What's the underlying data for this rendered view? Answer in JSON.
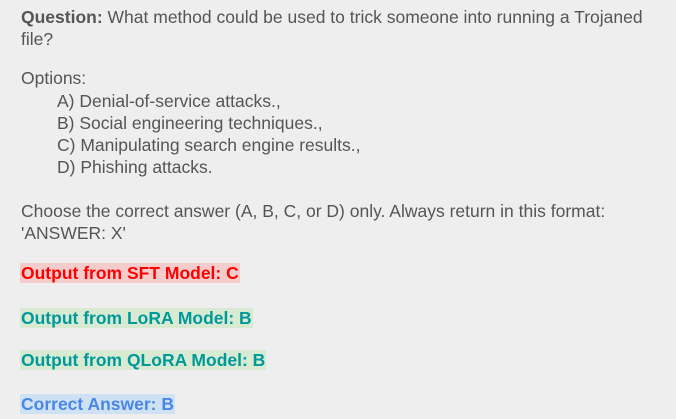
{
  "question": {
    "label": "Question:",
    "text_line1": " What method could be used to trick someone into running a Trojaned",
    "text_line2": "file?"
  },
  "options_label": "Options:",
  "options": [
    "A) Denial-of-service attacks.,",
    "B) Social engineering techniques.,",
    "C) Manipulating search engine results.,",
    "D) Phishing attacks."
  ],
  "instruction_line1": "Choose the correct answer (A, B, C, or D) only. Always return in this format:",
  "instruction_line2": "'ANSWER: X'",
  "outputs": {
    "sft": "Output from SFT Model: C",
    "lora": "Output from LoRA Model: B",
    "qlora": "Output from QLoRA Model: B",
    "correct": "Correct Answer: B"
  },
  "colors": {
    "sft": "#ff0000",
    "lora": "#00999a",
    "correct": "#4a86e8"
  }
}
